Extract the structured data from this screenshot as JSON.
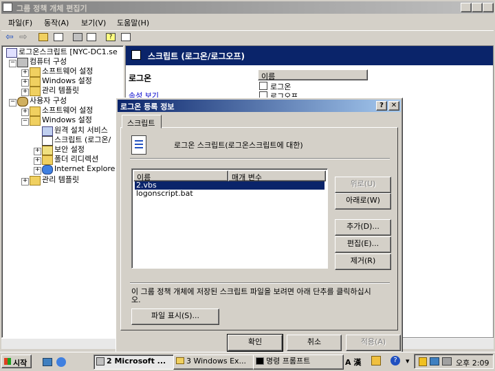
{
  "main_window": {
    "title": "그룹 정책 개체 편집기",
    "menu": [
      "파일(F)",
      "동작(A)",
      "보기(V)",
      "도움말(H)"
    ]
  },
  "tree": {
    "items": [
      {
        "label": "로그온스크립트 [NYC-DC1.se"
      },
      {
        "label": "컴퓨터 구성"
      },
      {
        "label": "소프트웨어 설정"
      },
      {
        "label": "Windows 설정"
      },
      {
        "label": "관리 템플릿"
      },
      {
        "label": "사용자 구성"
      },
      {
        "label": "소프트웨어 설정"
      },
      {
        "label": "Windows 설정"
      },
      {
        "label": "원격 설치 서비스"
      },
      {
        "label": "스크립트 (로그온/"
      },
      {
        "label": "보안 설정"
      },
      {
        "label": "폴더 리디렉션"
      },
      {
        "label": "Internet Explorer 유"
      },
      {
        "label": "관리 템플릿"
      }
    ]
  },
  "right_pane": {
    "header_title": "스크립트 (로그온/로그오프)",
    "section_title": "로그온",
    "link_text": "속성 보기",
    "column_header": "이름",
    "items": [
      "로그온",
      "로그오프"
    ]
  },
  "dialog": {
    "title": "로그온 등록 정보",
    "tab": "스크립트",
    "description": "로그온 스크립트(로그온스크립트에 대한)",
    "columns": [
      "이름",
      "매개 변수"
    ],
    "scripts": [
      "2.vbs",
      "logonscript.bat"
    ],
    "buttons": {
      "up": "위로(U)",
      "down": "아래로(W)",
      "add": "추가(D)...",
      "edit": "편집(E)...",
      "remove": "제거(R)"
    },
    "info_text": "이 그룹 정책 개체에 저장된 스크립트 파일을 보려면 아래 단추를 클릭하십시오.",
    "show_files": "파일 표시(S)...",
    "ok": "확인",
    "cancel": "취소",
    "apply": "적용(A)"
  },
  "taskbar": {
    "start": "시작",
    "tasks": [
      "2 Microsoft ...",
      "3 Windows Ex...",
      "명령 프롬프트"
    ],
    "lang": "A 漢",
    "clock": "오후 2:09"
  },
  "colors": {
    "title_active": "#0a246a",
    "selection": "#0a246a",
    "face": "#d4d0c8"
  }
}
